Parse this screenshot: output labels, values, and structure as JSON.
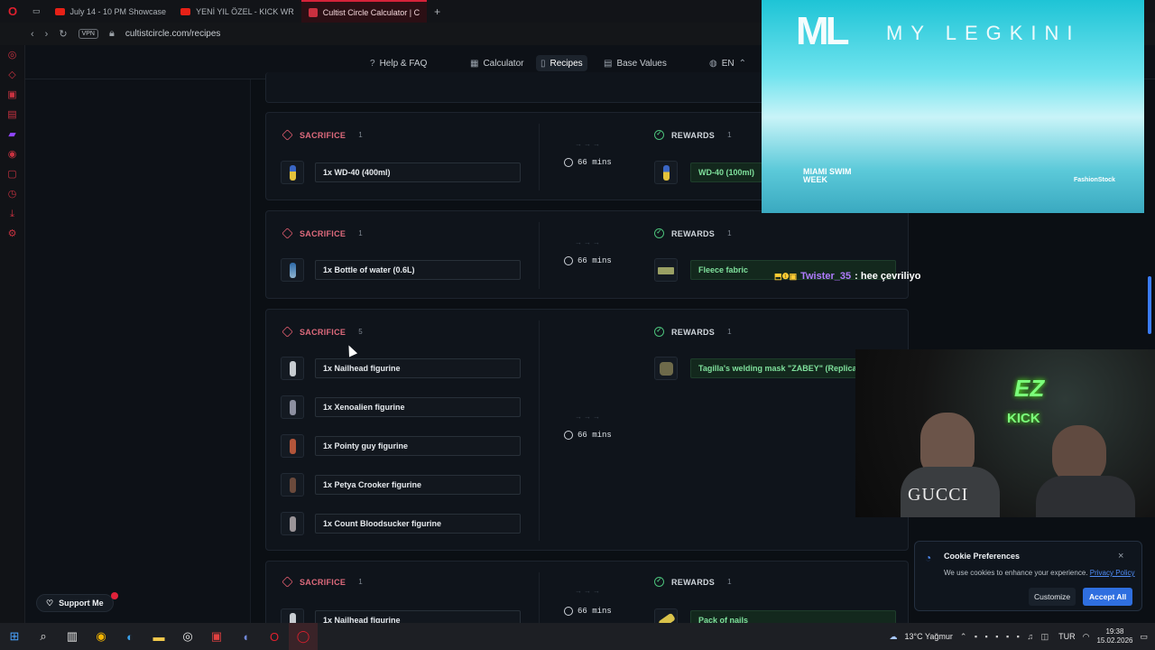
{
  "browser": {
    "tabs": [
      {
        "label": "July 14 - 10 PM Showcase",
        "icon": "youtube-icon"
      },
      {
        "label": "YENİ YIL ÖZEL - KICK WR",
        "icon": "youtube-icon"
      },
      {
        "label": "Cultist Circle Calculator | C",
        "icon": "cultist-circle-icon",
        "active": true
      }
    ],
    "vpn_label": "VPN",
    "url": "cultistcircle.com/recipes"
  },
  "nav": {
    "help": "Help & FAQ",
    "calculator": "Calculator",
    "recipes": "Recipes",
    "base_values": "Base Values",
    "lang": "EN"
  },
  "recipes": [
    {
      "sacrifice_label": "SACRIFICE",
      "sacrifice_count": "1",
      "items": [
        "1x WD-40 (400ml)"
      ],
      "time": "66 mins",
      "rewards_label": "REWARDS",
      "rewards_count": "1",
      "reward": "WD-40 (100ml)"
    },
    {
      "sacrifice_label": "SACRIFICE",
      "sacrifice_count": "1",
      "items": [
        "1x Bottle of water (0.6L)"
      ],
      "time": "66 mins",
      "rewards_label": "REWARDS",
      "rewards_count": "1",
      "reward": "Fleece fabric"
    },
    {
      "sacrifice_label": "SACRIFICE",
      "sacrifice_count": "5",
      "items": [
        "1x Nailhead figurine",
        "1x Xenoalien figurine",
        "1x Pointy guy figurine",
        "1x Petya Crooker figurine",
        "1x Count Bloodsucker figurine"
      ],
      "time": "66 mins",
      "rewards_label": "REWARDS",
      "rewards_count": "1",
      "reward": "Tagilla's welding mask \"ZABEY\" (Replica)"
    },
    {
      "sacrifice_label": "SACRIFICE",
      "sacrifice_count": "1",
      "items": [
        "1x Nailhead figurine"
      ],
      "time": "66 mins",
      "rewards_label": "REWARDS",
      "rewards_count": "1",
      "reward": "Pack of nails"
    }
  ],
  "stream": {
    "video_logo": "ML",
    "video_brand": "MY LEGKINI",
    "video_caption": "MIAMI SWIM WEEK",
    "video_watermark": "FashionStock",
    "chat_user": "Twister_35",
    "chat_message": ": hee çevriliyo",
    "cam_logo_ez": "EZ",
    "cam_logo_kick": "KICK",
    "cam_shirt": "GUCCI"
  },
  "cookie": {
    "title": "Cookie Preferences",
    "text": "We use cookies to enhance your experience.",
    "policy_link": "Privacy Policy",
    "customize": "Customize",
    "accept": "Accept All"
  },
  "support_label": "Support Me",
  "taskbar": {
    "weather": "13°C Yağmur",
    "lang": "TUR",
    "time": "19:38",
    "date": "15.02.2026"
  },
  "colors": {
    "sacrifice": "#e06b7d",
    "reward_text": "#7fe09c",
    "accent": "#2f6fe0"
  }
}
